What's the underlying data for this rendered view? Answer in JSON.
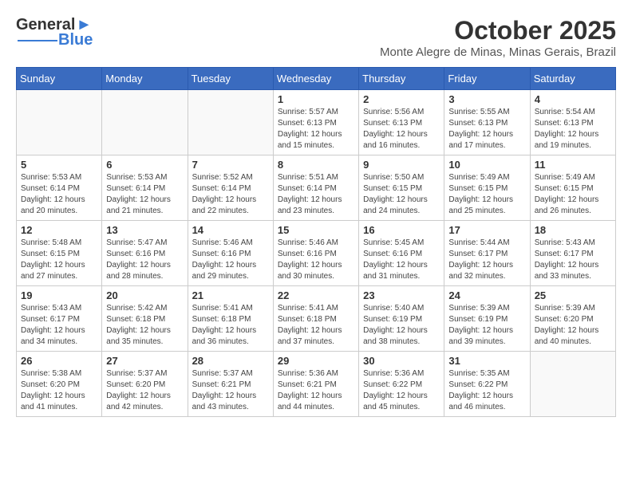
{
  "header": {
    "logo_text_general": "General",
    "logo_text_blue": "Blue",
    "month_year": "October 2025",
    "location": "Monte Alegre de Minas, Minas Gerais, Brazil"
  },
  "weekdays": [
    "Sunday",
    "Monday",
    "Tuesday",
    "Wednesday",
    "Thursday",
    "Friday",
    "Saturday"
  ],
  "weeks": [
    [
      {
        "day": "",
        "info": ""
      },
      {
        "day": "",
        "info": ""
      },
      {
        "day": "",
        "info": ""
      },
      {
        "day": "1",
        "info": "Sunrise: 5:57 AM\nSunset: 6:13 PM\nDaylight: 12 hours\nand 15 minutes."
      },
      {
        "day": "2",
        "info": "Sunrise: 5:56 AM\nSunset: 6:13 PM\nDaylight: 12 hours\nand 16 minutes."
      },
      {
        "day": "3",
        "info": "Sunrise: 5:55 AM\nSunset: 6:13 PM\nDaylight: 12 hours\nand 17 minutes."
      },
      {
        "day": "4",
        "info": "Sunrise: 5:54 AM\nSunset: 6:13 PM\nDaylight: 12 hours\nand 19 minutes."
      }
    ],
    [
      {
        "day": "5",
        "info": "Sunrise: 5:53 AM\nSunset: 6:14 PM\nDaylight: 12 hours\nand 20 minutes."
      },
      {
        "day": "6",
        "info": "Sunrise: 5:53 AM\nSunset: 6:14 PM\nDaylight: 12 hours\nand 21 minutes."
      },
      {
        "day": "7",
        "info": "Sunrise: 5:52 AM\nSunset: 6:14 PM\nDaylight: 12 hours\nand 22 minutes."
      },
      {
        "day": "8",
        "info": "Sunrise: 5:51 AM\nSunset: 6:14 PM\nDaylight: 12 hours\nand 23 minutes."
      },
      {
        "day": "9",
        "info": "Sunrise: 5:50 AM\nSunset: 6:15 PM\nDaylight: 12 hours\nand 24 minutes."
      },
      {
        "day": "10",
        "info": "Sunrise: 5:49 AM\nSunset: 6:15 PM\nDaylight: 12 hours\nand 25 minutes."
      },
      {
        "day": "11",
        "info": "Sunrise: 5:49 AM\nSunset: 6:15 PM\nDaylight: 12 hours\nand 26 minutes."
      }
    ],
    [
      {
        "day": "12",
        "info": "Sunrise: 5:48 AM\nSunset: 6:15 PM\nDaylight: 12 hours\nand 27 minutes."
      },
      {
        "day": "13",
        "info": "Sunrise: 5:47 AM\nSunset: 6:16 PM\nDaylight: 12 hours\nand 28 minutes."
      },
      {
        "day": "14",
        "info": "Sunrise: 5:46 AM\nSunset: 6:16 PM\nDaylight: 12 hours\nand 29 minutes."
      },
      {
        "day": "15",
        "info": "Sunrise: 5:46 AM\nSunset: 6:16 PM\nDaylight: 12 hours\nand 30 minutes."
      },
      {
        "day": "16",
        "info": "Sunrise: 5:45 AM\nSunset: 6:16 PM\nDaylight: 12 hours\nand 31 minutes."
      },
      {
        "day": "17",
        "info": "Sunrise: 5:44 AM\nSunset: 6:17 PM\nDaylight: 12 hours\nand 32 minutes."
      },
      {
        "day": "18",
        "info": "Sunrise: 5:43 AM\nSunset: 6:17 PM\nDaylight: 12 hours\nand 33 minutes."
      }
    ],
    [
      {
        "day": "19",
        "info": "Sunrise: 5:43 AM\nSunset: 6:17 PM\nDaylight: 12 hours\nand 34 minutes."
      },
      {
        "day": "20",
        "info": "Sunrise: 5:42 AM\nSunset: 6:18 PM\nDaylight: 12 hours\nand 35 minutes."
      },
      {
        "day": "21",
        "info": "Sunrise: 5:41 AM\nSunset: 6:18 PM\nDaylight: 12 hours\nand 36 minutes."
      },
      {
        "day": "22",
        "info": "Sunrise: 5:41 AM\nSunset: 6:18 PM\nDaylight: 12 hours\nand 37 minutes."
      },
      {
        "day": "23",
        "info": "Sunrise: 5:40 AM\nSunset: 6:19 PM\nDaylight: 12 hours\nand 38 minutes."
      },
      {
        "day": "24",
        "info": "Sunrise: 5:39 AM\nSunset: 6:19 PM\nDaylight: 12 hours\nand 39 minutes."
      },
      {
        "day": "25",
        "info": "Sunrise: 5:39 AM\nSunset: 6:20 PM\nDaylight: 12 hours\nand 40 minutes."
      }
    ],
    [
      {
        "day": "26",
        "info": "Sunrise: 5:38 AM\nSunset: 6:20 PM\nDaylight: 12 hours\nand 41 minutes."
      },
      {
        "day": "27",
        "info": "Sunrise: 5:37 AM\nSunset: 6:20 PM\nDaylight: 12 hours\nand 42 minutes."
      },
      {
        "day": "28",
        "info": "Sunrise: 5:37 AM\nSunset: 6:21 PM\nDaylight: 12 hours\nand 43 minutes."
      },
      {
        "day": "29",
        "info": "Sunrise: 5:36 AM\nSunset: 6:21 PM\nDaylight: 12 hours\nand 44 minutes."
      },
      {
        "day": "30",
        "info": "Sunrise: 5:36 AM\nSunset: 6:22 PM\nDaylight: 12 hours\nand 45 minutes."
      },
      {
        "day": "31",
        "info": "Sunrise: 5:35 AM\nSunset: 6:22 PM\nDaylight: 12 hours\nand 46 minutes."
      },
      {
        "day": "",
        "info": ""
      }
    ]
  ]
}
